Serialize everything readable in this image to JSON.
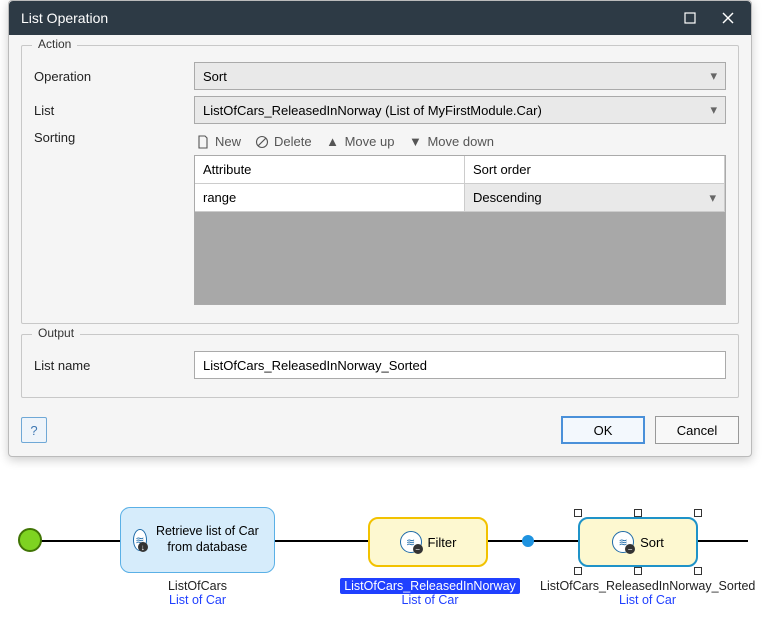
{
  "dialog": {
    "title": "List Operation",
    "action": {
      "legend": "Action",
      "operation_label": "Operation",
      "operation_value": "Sort",
      "list_label": "List",
      "list_value": "ListOfCars_ReleasedInNorway (List of MyFirstModule.Car)",
      "sorting_label": "Sorting"
    },
    "output": {
      "legend": "Output",
      "listname_label": "List name",
      "listname_value": "ListOfCars_ReleasedInNorway_Sorted"
    },
    "toolbar": {
      "new": "New",
      "delete": "Delete",
      "moveup": "Move up",
      "movedown": "Move down"
    },
    "grid": {
      "col_attribute": "Attribute",
      "col_sortorder": "Sort order",
      "rows": [
        {
          "attribute": "range",
          "order": "Descending"
        }
      ]
    },
    "buttons": {
      "ok": "OK",
      "cancel": "Cancel"
    }
  },
  "workflow": {
    "nodes": {
      "retrieve": {
        "label": "Retrieve list of Car from database",
        "caption_name": "ListOfCars",
        "caption_type": "List of Car"
      },
      "filter": {
        "label": "Filter",
        "caption_name": "ListOfCars_ReleasedInNorway",
        "caption_type": "List of Car"
      },
      "sort": {
        "label": "Sort",
        "caption_name": "ListOfCars_ReleasedInNorway_Sorted",
        "caption_type": "List of Car"
      }
    }
  }
}
